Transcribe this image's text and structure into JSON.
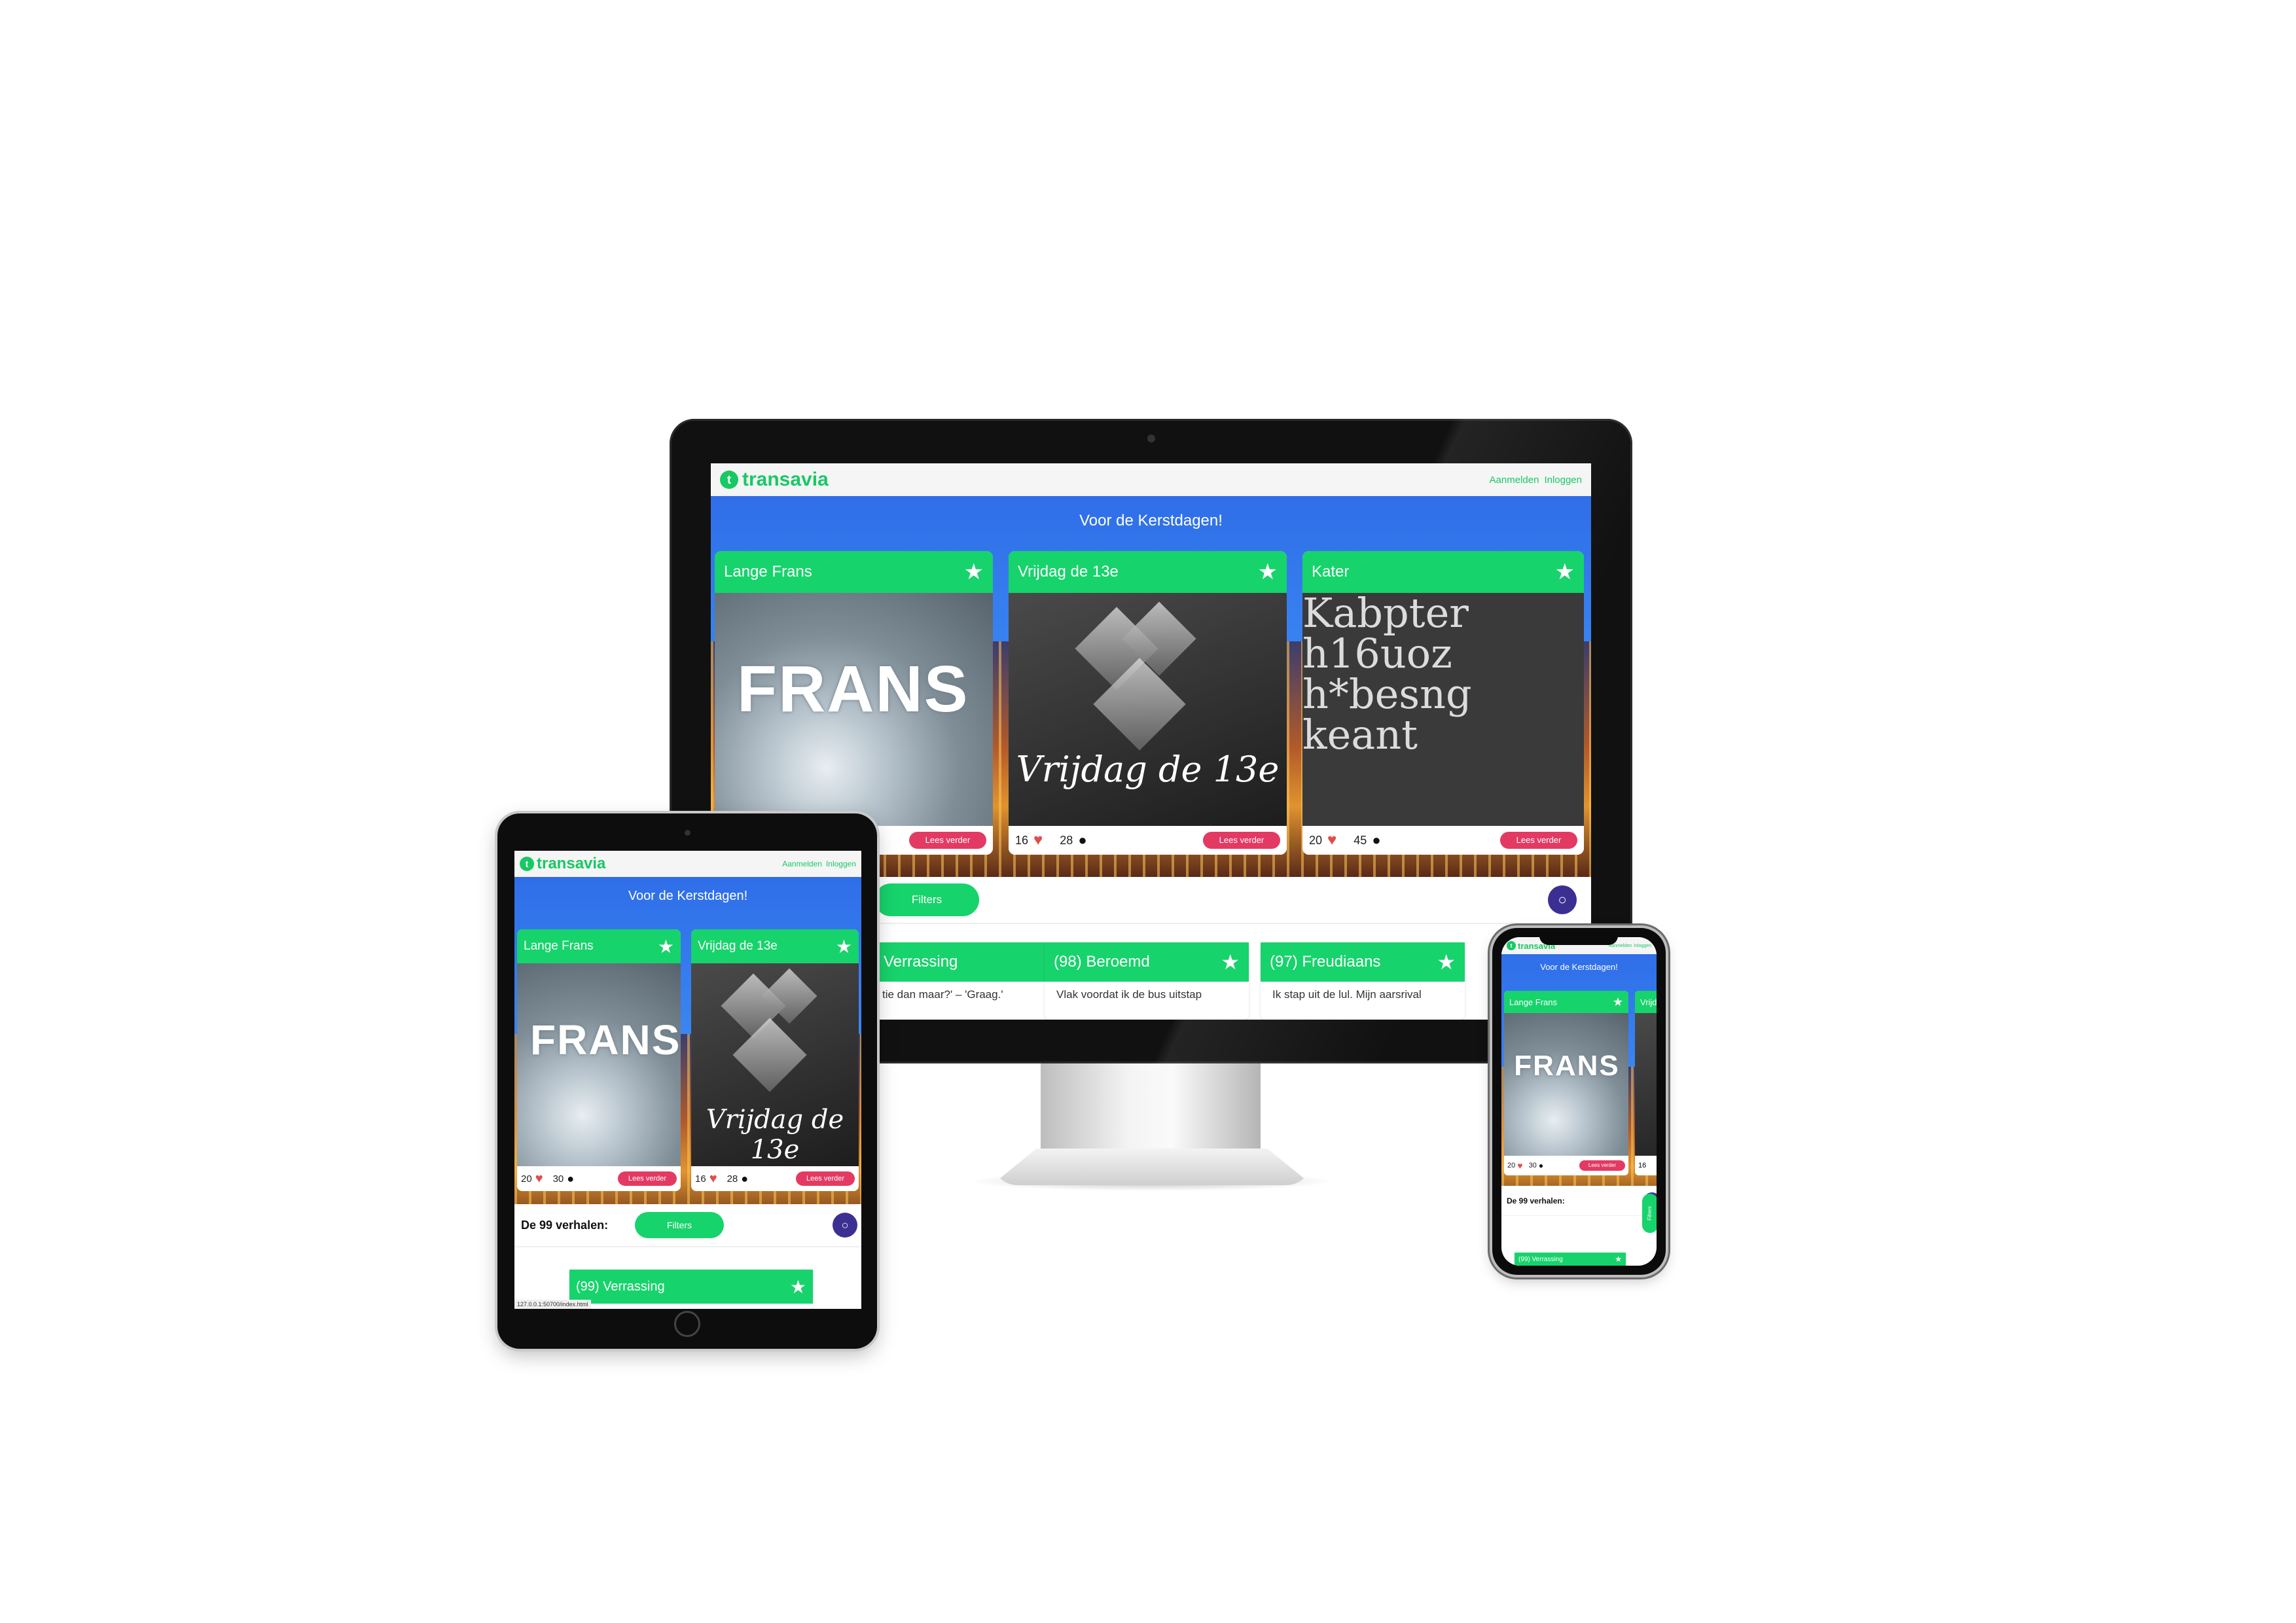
{
  "site": {
    "logo": "transavia",
    "logo_mark": "t",
    "nav": [
      "Aanmelden",
      "Inloggen"
    ],
    "hero_title": "Voor de Kerstdagen!",
    "count_label": "De 99 verhalen:",
    "filters_label": "Filters",
    "read_more": "Lees verder",
    "url": "127.0.0.1:50700/index.html"
  },
  "cards": [
    {
      "title": "Lange Frans",
      "likes": "20",
      "readers": "30",
      "image_text": "FRANS"
    },
    {
      "title": "Vrijdag de 13e",
      "likes": "16",
      "readers": "28",
      "image_text": "Vrijdag de 13e"
    },
    {
      "title": "Kater",
      "likes": "20",
      "readers": "45",
      "image_text": "Kabpterh16uozh*besngkeant"
    }
  ],
  "stories": [
    {
      "title": "(99) Verrassing",
      "snippet": "'Wie dan maar?' – 'Graag.'"
    },
    {
      "title": "(98) Beroemd",
      "snippet": "Vlak voordat ik de bus uitstap"
    },
    {
      "title": "(97) Freudiaans",
      "snippet": "Ik stap uit de lul. Mijn aarsrival"
    }
  ],
  "desktop_visible": {
    "story_0_title": "Verrassing",
    "story_0_snippet": "tie dan maar?' – 'Graag.'"
  },
  "icons": {
    "star": "star-icon",
    "heart": "heart-icon",
    "person": "person-icon",
    "search": "search-icon"
  },
  "colors": {
    "brand_green": "#17d36b",
    "read_more": "#e33a63",
    "search": "#3b3092",
    "hero_blue": "#2f6ee8"
  }
}
